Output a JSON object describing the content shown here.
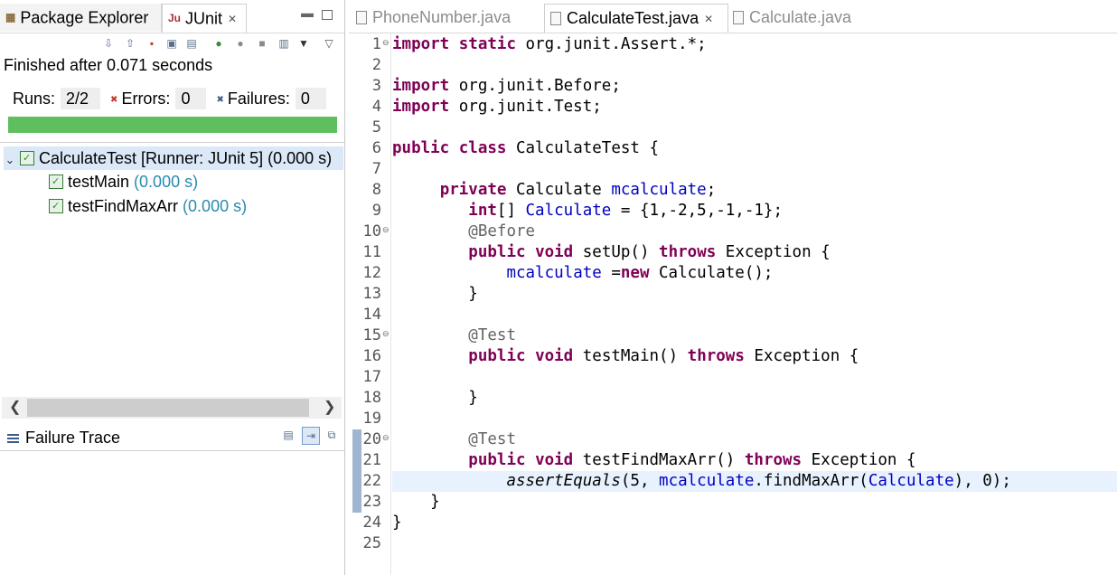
{
  "left_panel": {
    "tabs": [
      {
        "label": "Package Explorer",
        "icon": "package-icon"
      },
      {
        "label": "JUnit",
        "icon": "junit-icon",
        "active": true
      }
    ],
    "status": "Finished after 0.071 seconds",
    "runs_label": "Runs:",
    "runs_value": "2/2",
    "errors_label": "Errors:",
    "errors_value": "0",
    "failures_label": "Failures:",
    "failures_value": "0",
    "progress_color": "#5fbf5f",
    "progress_fraction": 1.0,
    "tree": [
      {
        "label": "CalculateTest [Runner: JUnit 5] (0.000 s)",
        "level": 0,
        "expanded": true,
        "selected": true
      },
      {
        "label": "testMain",
        "time": "(0.000 s)",
        "level": 1
      },
      {
        "label": "testFindMaxArr",
        "time": "(0.000 s)",
        "level": 1
      }
    ],
    "failure_trace_title": "Failure Trace"
  },
  "editor": {
    "tabs": [
      {
        "label": "PhoneNumber.java",
        "active": false
      },
      {
        "label": "CalculateTest.java",
        "active": true
      },
      {
        "label": "Calculate.java",
        "active": false
      }
    ],
    "current_line": 22,
    "lines": [
      {
        "n": "1",
        "text": "import static org.junit.Assert.*;"
      },
      {
        "n": "2",
        "text": ""
      },
      {
        "n": "3",
        "text": "import org.junit.Before;"
      },
      {
        "n": "4",
        "text": "import org.junit.Test;"
      },
      {
        "n": "5",
        "text": ""
      },
      {
        "n": "6",
        "text": "public class CalculateTest {"
      },
      {
        "n": "7",
        "text": ""
      },
      {
        "n": "8",
        "text": "     private Calculate mcalculate;"
      },
      {
        "n": "9",
        "text": "        int[] Calculate = {1,-2,5,-1,-1};"
      },
      {
        "n": "10",
        "text": "        @Before"
      },
      {
        "n": "11",
        "text": "        public void setUp() throws Exception {"
      },
      {
        "n": "12",
        "text": "            mcalculate =new Calculate();"
      },
      {
        "n": "13",
        "text": "        }"
      },
      {
        "n": "14",
        "text": ""
      },
      {
        "n": "15",
        "text": "        @Test"
      },
      {
        "n": "16",
        "text": "        public void testMain() throws Exception {"
      },
      {
        "n": "17",
        "text": ""
      },
      {
        "n": "18",
        "text": "        }"
      },
      {
        "n": "19",
        "text": ""
      },
      {
        "n": "20",
        "text": "        @Test"
      },
      {
        "n": "21",
        "text": "        public void testFindMaxArr() throws Exception {"
      },
      {
        "n": "22",
        "text": "            assertEquals(5, mcalculate.findMaxArr(Calculate), 0);"
      },
      {
        "n": "23",
        "text": "    }"
      },
      {
        "n": "24",
        "text": "}"
      },
      {
        "n": "25",
        "text": ""
      }
    ]
  },
  "colors": {
    "keyword": "#7f0055",
    "field": "#0000c0",
    "annotation": "#646464",
    "current_line": "#e8f2fe",
    "time_text": "#2a8ab0"
  }
}
